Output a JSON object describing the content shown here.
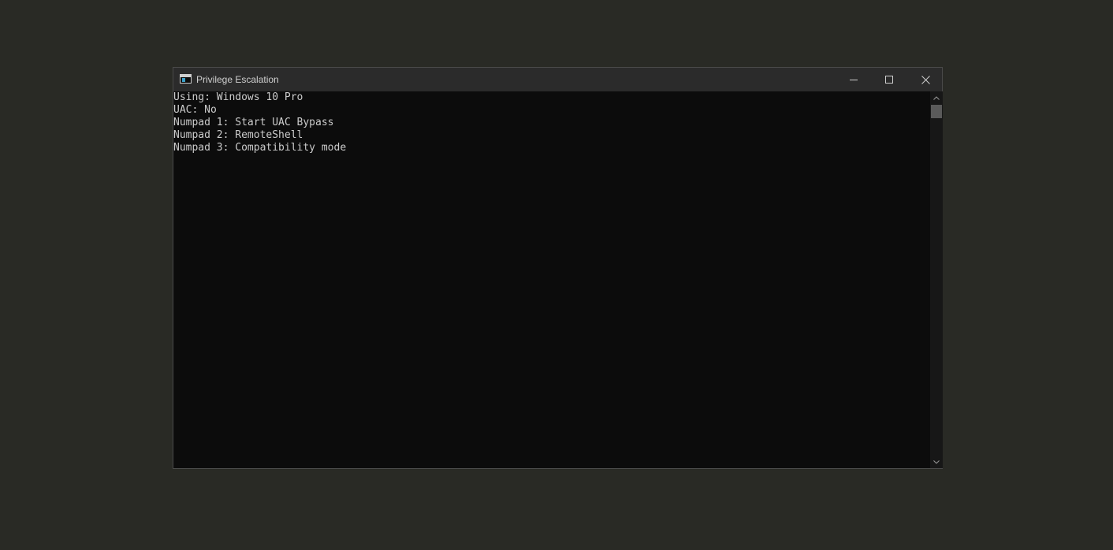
{
  "window": {
    "title": "Privilege Escalation",
    "icon": "console-icon",
    "controls": {
      "minimize": "minimize-icon",
      "maximize": "maximize-icon",
      "close": "close-icon"
    }
  },
  "console": {
    "lines": [
      "Using: Windows 10 Pro",
      "UAC: No",
      "Numpad 1: Start UAC Bypass",
      "Numpad 2: RemoteShell",
      "Numpad 3: Compatibility mode"
    ]
  },
  "colors": {
    "desktop": "#292a25",
    "titlebar": "#2b2b2b",
    "console_bg": "#0c0c0c",
    "console_text": "#cccccc"
  }
}
